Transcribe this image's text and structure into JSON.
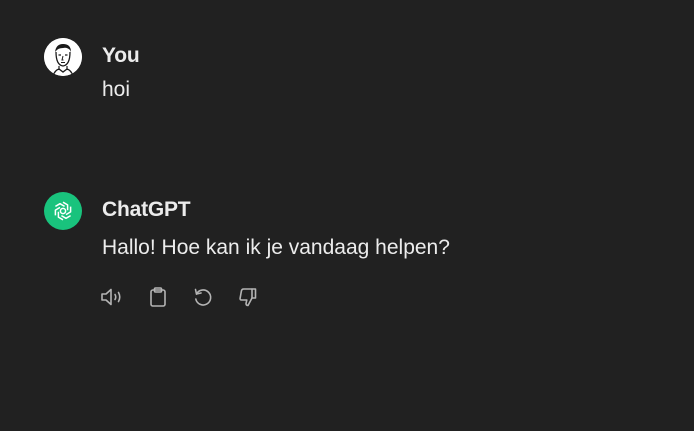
{
  "conversation": {
    "messages": [
      {
        "role": "user",
        "author": "You",
        "text": "hoi"
      },
      {
        "role": "assistant",
        "author": "ChatGPT",
        "text": "Hallo! Hoe kan ik je vandaag helpen?",
        "actions": [
          {
            "icon": "speaker-icon"
          },
          {
            "icon": "clipboard-icon"
          },
          {
            "icon": "regenerate-icon"
          },
          {
            "icon": "thumbs-down-icon"
          }
        ]
      }
    ]
  },
  "colors": {
    "background": "#212121",
    "text": "#ececec",
    "icon": "#b4b4b4",
    "bot_avatar": "#19c37d",
    "user_avatar_bg": "#ffffff"
  }
}
